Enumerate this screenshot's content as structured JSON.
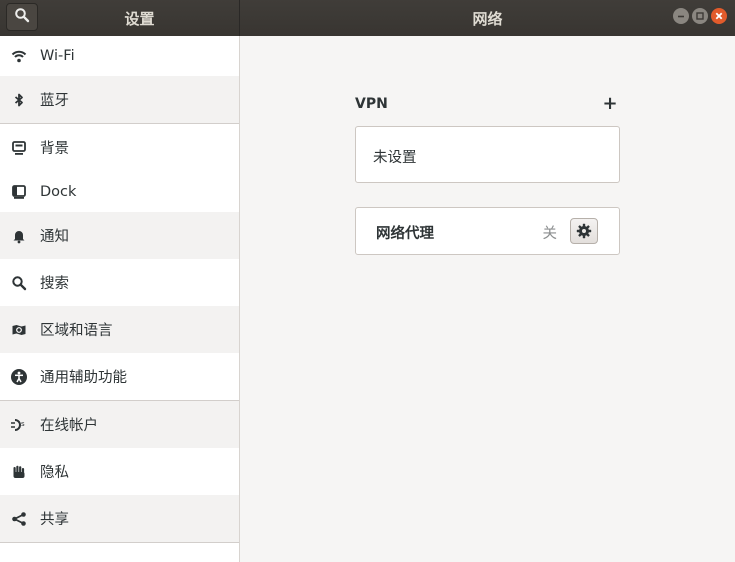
{
  "header": {
    "left_title": "设置",
    "main_title": "网络"
  },
  "sidebar": {
    "items": [
      {
        "label": "Wi-Fi",
        "icon": "wifi-icon"
      },
      {
        "label": "蓝牙",
        "icon": "bluetooth-icon"
      },
      {
        "label": "背景",
        "icon": "background-icon"
      },
      {
        "label": "Dock",
        "icon": "dock-icon"
      },
      {
        "label": "通知",
        "icon": "bell-icon"
      },
      {
        "label": "搜索",
        "icon": "search-icon"
      },
      {
        "label": "区域和语言",
        "icon": "region-icon"
      },
      {
        "label": "通用辅助功能",
        "icon": "accessibility-icon"
      },
      {
        "label": "在线帐户",
        "icon": "online-accounts-icon"
      },
      {
        "label": "隐私",
        "icon": "privacy-hand-icon"
      },
      {
        "label": "共享",
        "icon": "share-icon"
      }
    ]
  },
  "main": {
    "vpn": {
      "heading": "VPN",
      "add_label": "+",
      "status": "未设置"
    },
    "proxy": {
      "label": "网络代理",
      "state": "关"
    }
  },
  "colors": {
    "headerbar": "#3c3935",
    "close_button": "#e25b2b",
    "sidebar_bg": "#ffffff",
    "content_bg": "#f6f5f4"
  }
}
